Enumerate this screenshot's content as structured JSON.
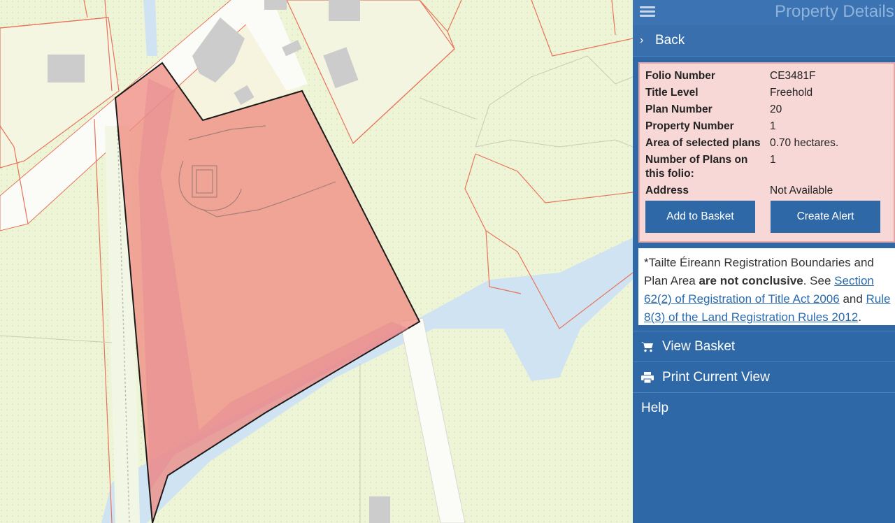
{
  "header": {
    "title": "Property Details",
    "menu_icon": "hamburger-icon"
  },
  "back": {
    "label": "Back",
    "icon": "chevron-right-icon"
  },
  "details": [
    {
      "label": "Folio Number",
      "value": "CE3481F"
    },
    {
      "label": "Title Level",
      "value": "Freehold"
    },
    {
      "label": "Plan Number",
      "value": "20"
    },
    {
      "label": "Property Number",
      "value": "1"
    },
    {
      "label": "Area of selected plans",
      "value": "0.70 hectares."
    },
    {
      "label": "Number of Plans on this folio:",
      "value": "1"
    },
    {
      "label": "Address",
      "value": "Not Available"
    }
  ],
  "buttons": {
    "add_to_basket": "Add to Basket",
    "create_alert": "Create Alert"
  },
  "notice": {
    "prefix": "*Tailte Éireann Registration Boundaries and Plan Area ",
    "bold": "are not conclusive",
    "mid1": ". See ",
    "link1": "Section 62(2) of Registration of Title Act 2006",
    "mid2": " and ",
    "link2": "Rule 8(3) of the Land Registration Rules 2012",
    "suffix": "."
  },
  "menu": [
    {
      "label": "View Basket",
      "icon": "shopping-cart-icon"
    },
    {
      "label": "Print Current View",
      "icon": "printer-icon"
    },
    {
      "label": "Help",
      "icon": ""
    }
  ],
  "colors": {
    "panel": "#2f68a6",
    "selected_parcel": "#f08a80",
    "water": "#cfe3f2",
    "land": "#eef4d6",
    "boundary": "#e8735a"
  }
}
